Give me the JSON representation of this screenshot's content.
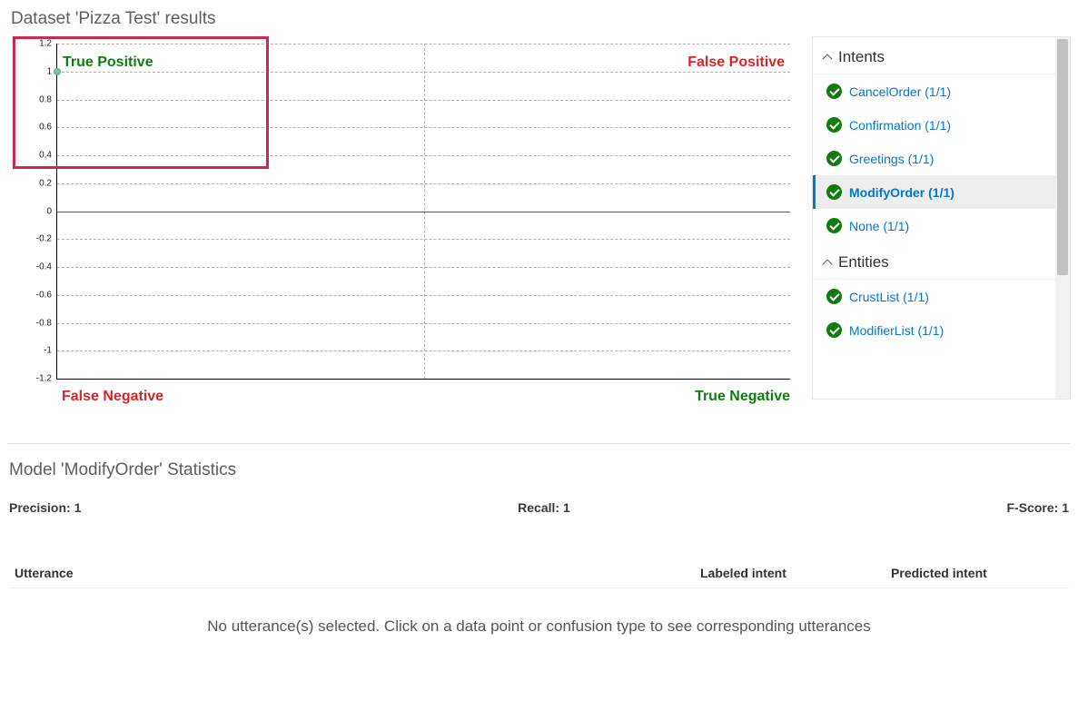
{
  "header": {
    "title": "Dataset 'Pizza Test' results"
  },
  "chart_data": {
    "type": "scatter",
    "x": [
      0
    ],
    "y": [
      1
    ],
    "xlim": [
      0,
      1
    ],
    "ylim": [
      -1.2,
      1.2
    ],
    "yticks": [
      -1.2,
      -1,
      -0.8,
      -0.6,
      -0.4,
      -0.2,
      0,
      0.2,
      0.4,
      0.6,
      0.8,
      1,
      1.2
    ],
    "quadrant_labels": {
      "tl": "True Positive",
      "tr": "False Positive",
      "bl": "False Negative",
      "br": "True Negative"
    }
  },
  "side": {
    "sections": {
      "intents": {
        "title": "Intents",
        "items": [
          {
            "label": "CancelOrder (1/1)",
            "selected": false
          },
          {
            "label": "Confirmation (1/1)",
            "selected": false
          },
          {
            "label": "Greetings (1/1)",
            "selected": false
          },
          {
            "label": "ModifyOrder (1/1)",
            "selected": true
          },
          {
            "label": "None (1/1)",
            "selected": false
          }
        ]
      },
      "entities": {
        "title": "Entities",
        "items": [
          {
            "label": "CrustList (1/1)",
            "selected": false
          },
          {
            "label": "ModifierList (1/1)",
            "selected": false
          }
        ]
      }
    }
  },
  "stats": {
    "title": "Model 'ModifyOrder' Statistics",
    "precision_label": "Precision:",
    "precision_value": "1",
    "recall_label": "Recall:",
    "recall_value": "1",
    "fscore_label": "F-Score:",
    "fscore_value": "1"
  },
  "table": {
    "col_utterance": "Utterance",
    "col_labeled": "Labeled intent",
    "col_predicted": "Predicted intent",
    "empty_message": "No utterance(s) selected. Click on a data point or confusion type to see corresponding utterances"
  }
}
